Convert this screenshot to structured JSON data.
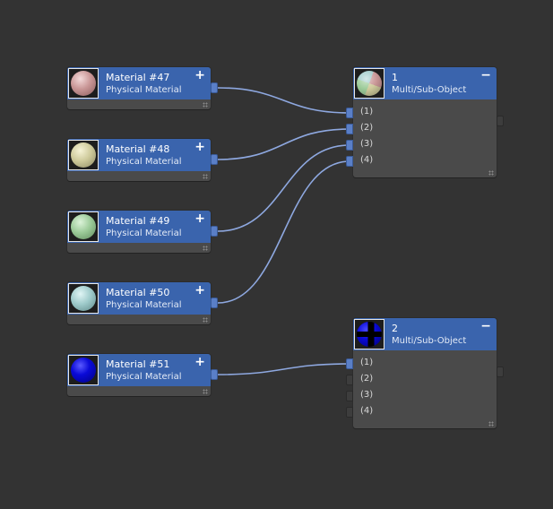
{
  "materials": [
    {
      "title": "Material #47",
      "subtitle": "Physical Material",
      "button": "+",
      "swatch": "#c99696"
    },
    {
      "title": "Material #48",
      "subtitle": "Physical Material",
      "button": "+",
      "swatch": "#cfcb9c"
    },
    {
      "title": "Material #49",
      "subtitle": "Physical Material",
      "button": "+",
      "swatch": "#9ccb99"
    },
    {
      "title": "Material #50",
      "subtitle": "Physical Material",
      "button": "+",
      "swatch": "#9fcbcb"
    },
    {
      "title": "Material #51",
      "subtitle": "Physical Material",
      "button": "+",
      "swatch": "#0a0ad8"
    }
  ],
  "multi": [
    {
      "title": "1",
      "subtitle": "Multi/Sub-Object",
      "button": "−",
      "slots": [
        "(1)",
        "(2)",
        "(3)",
        "(4)"
      ]
    },
    {
      "title": "2",
      "subtitle": "Multi/Sub-Object",
      "button": "−",
      "slots": [
        "(1)",
        "(2)",
        "(3)",
        "(4)"
      ]
    }
  ],
  "colors": {
    "canvas": "#333333",
    "header": "#3a64ad",
    "wire": "#8ea8e0",
    "node_body": "#4a4a4a"
  }
}
